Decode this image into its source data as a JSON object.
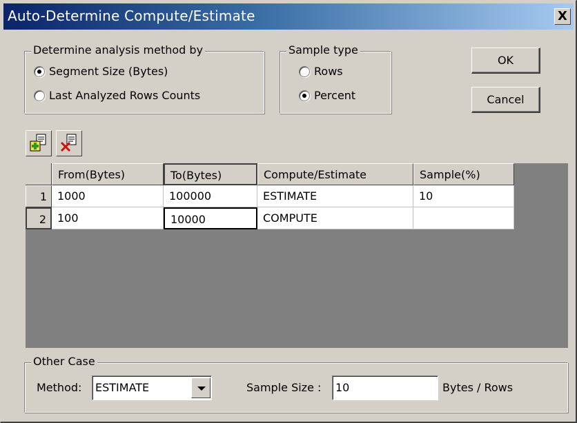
{
  "window": {
    "title": "Auto-Determine Compute/Estimate",
    "close_label": "X"
  },
  "analysis_method": {
    "label": "Determine analysis method by",
    "options": [
      {
        "label": "Segment Size (Bytes)",
        "checked": true
      },
      {
        "label": "Last Analyzed Rows Counts",
        "checked": false
      }
    ]
  },
  "sample_type": {
    "label": "Sample type",
    "options": [
      {
        "label": "Rows",
        "checked": false
      },
      {
        "label": "Percent",
        "checked": true
      }
    ]
  },
  "buttons": {
    "ok": "OK",
    "cancel": "Cancel"
  },
  "toolbar": {
    "add_row_icon": "add-row-icon",
    "delete_row_icon": "delete-row-icon"
  },
  "grid": {
    "columns": [
      "From(Bytes)",
      "To(Bytes)",
      "Compute/Estimate",
      "Sample(%)"
    ],
    "rows": [
      {
        "num": "1",
        "cells": [
          "1000",
          "100000",
          "ESTIMATE",
          "10"
        ]
      },
      {
        "num": "2",
        "cells": [
          "100",
          "10000",
          "COMPUTE",
          ""
        ]
      }
    ]
  },
  "other_case": {
    "label": "Other Case",
    "method_label": "Method:",
    "method_value": "ESTIMATE",
    "sample_size_label": "Sample Size :",
    "sample_size_value": "10",
    "units_label": "Bytes / Rows"
  },
  "colors": {
    "title_gradient_start": "#0a246a",
    "title_gradient_end": "#a6caf0",
    "face": "#d4d0c8",
    "grid_background": "#808080"
  }
}
